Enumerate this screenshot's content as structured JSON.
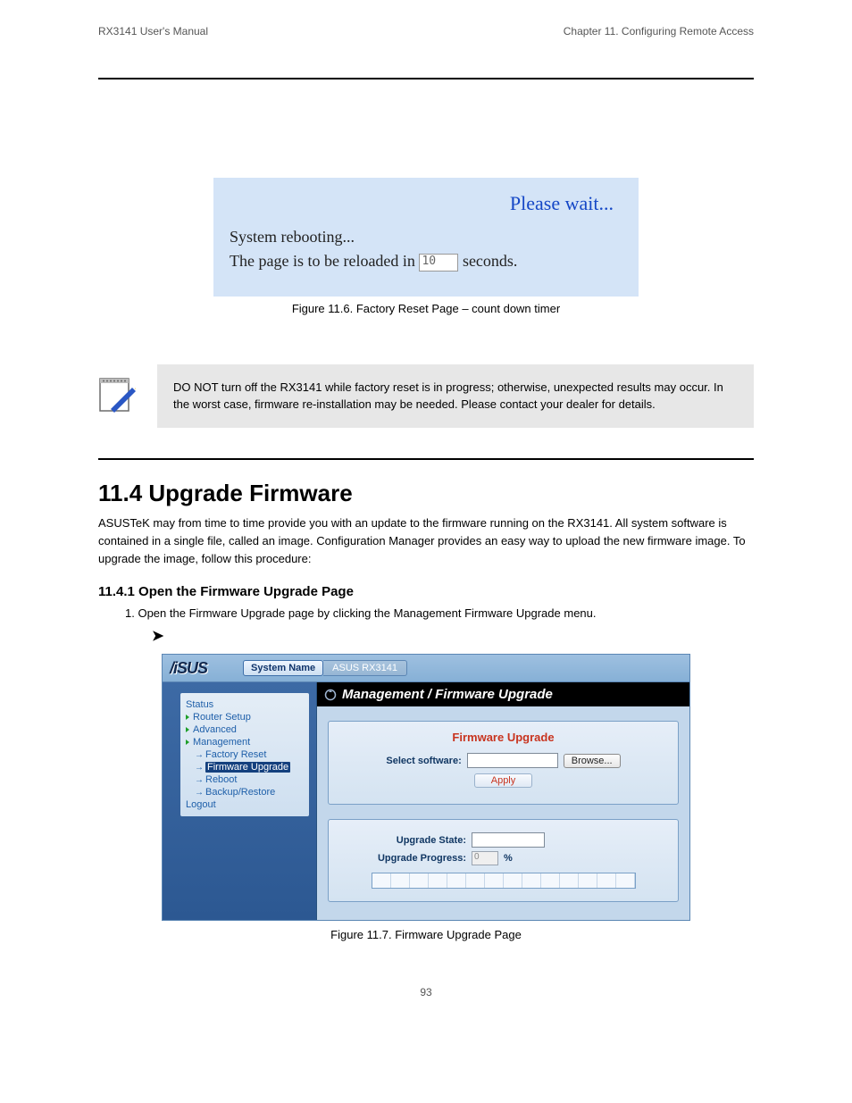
{
  "header": {
    "left": "RX3141 User's Manual",
    "right": "Chapter 11. Configuring Remote Access"
  },
  "reboot": {
    "wait": "Please wait...",
    "line1": "System rebooting...",
    "line2_a": "The page is to be reloaded in ",
    "line2_val": "10",
    "line2_b": " seconds.",
    "caption": "Figure 11.6. Factory Reset Page – count down timer"
  },
  "note": {
    "text": "DO NOT turn off the RX3141 while factory reset is in progress; otherwise, unexpected results may occur. In the worst case, firmware re-installation may be needed. Please contact your dealer for details."
  },
  "firmware": {
    "h": "11.4 Upgrade Firmware",
    "p": "ASUSTeK may from time to time provide you with an update to the firmware running on the RX3141. All system software is contained in a single file, called an image. Configuration Manager provides an easy way to upload the new firmware image. To upgrade the image, follow this procedure:",
    "sub": "11.4.1 Open the Firmware Upgrade Page",
    "step1": "Open the Firmware Upgrade page by clicking the Management  Firmware Upgrade menu."
  },
  "router": {
    "sys_label": "System Name",
    "sys_val": "ASUS RX3141",
    "logo": "/iSUS",
    "nav": {
      "status": "Status",
      "router": "Router Setup",
      "advanced": "Advanced",
      "mgmt": "Management",
      "factory": "Factory Reset",
      "fw": "Firmware Upgrade",
      "reboot": "Reboot",
      "backup": "Backup/Restore",
      "logout": "Logout"
    },
    "main_title": "Management / Firmware Upgrade",
    "panel_h": "Firmware Upgrade",
    "select": "Select software:",
    "browse": "Browse...",
    "apply": "Apply",
    "state_label": "Upgrade State:",
    "prog_label": "Upgrade Progress:",
    "prog_val": "0",
    "prog_unit": "%"
  },
  "caption2": "Figure 11.7. Firmware Upgrade Page",
  "footer": "93"
}
